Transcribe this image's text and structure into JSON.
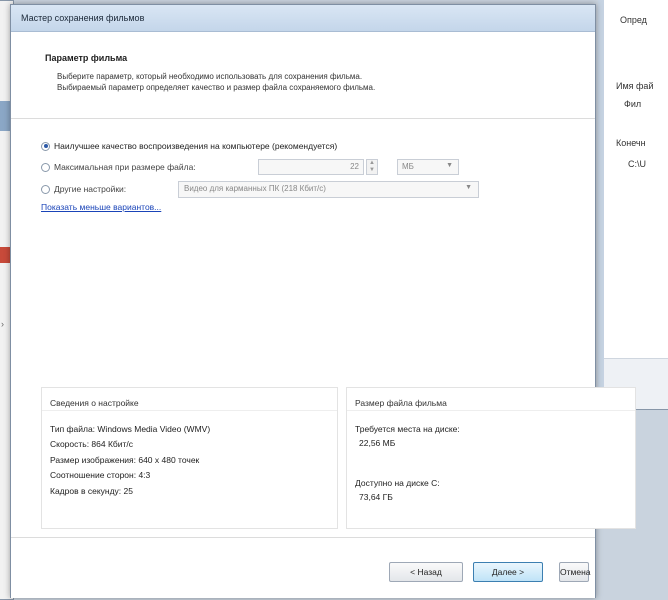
{
  "window": {
    "title": "Мастер сохранения фильмов"
  },
  "header": {
    "title": "Параметр фильма",
    "desc1": "Выберите параметр, который необходимо использовать для сохранения фильма.",
    "desc2": "Выбираемый параметр определяет качество и размер файла сохраняемого фильма."
  },
  "options": {
    "best_quality": "Наилучшее качество воспроизведения на компьютере (рекомендуется)",
    "max_file_size": "Максимальная при размере файла:",
    "size_value": "22",
    "size_unit": "МБ",
    "other": "Другие настройки:",
    "other_value": "Видео для карманных ПК (218 Кбит/с)",
    "selected": "best_quality"
  },
  "more_link": "Показать меньше вариантов...",
  "settings_info": {
    "title": "Сведения о настройке",
    "file_type": "Тип файла: Windows Media Video (WMV)",
    "speed": "Скорость: 864 Кбит/с",
    "resolution": "Размер изображения: 640 x 480 точек",
    "aspect": "Соотношение сторон: 4:3",
    "fps": "Кадров в секунду: 25"
  },
  "file_size": {
    "title": "Размер файла фильма",
    "required_label": "Требуется места на диске:",
    "required_value": "22,56 МБ",
    "available_label": "Доступно на диске C:",
    "available_value": "73,64 ГБ"
  },
  "buttons": {
    "back": "< Назад",
    "next": "Далее >",
    "cancel": "Отмена"
  },
  "background_window": {
    "label1": "Опред",
    "label2": "Имя фай",
    "label3": "Фил",
    "label4": "Конечн",
    "label5": "C:\\U"
  },
  "colors": {
    "link": "#1a44b8",
    "titlebar": "#c4d6ea",
    "default_button_border": "#3c7fb1"
  }
}
